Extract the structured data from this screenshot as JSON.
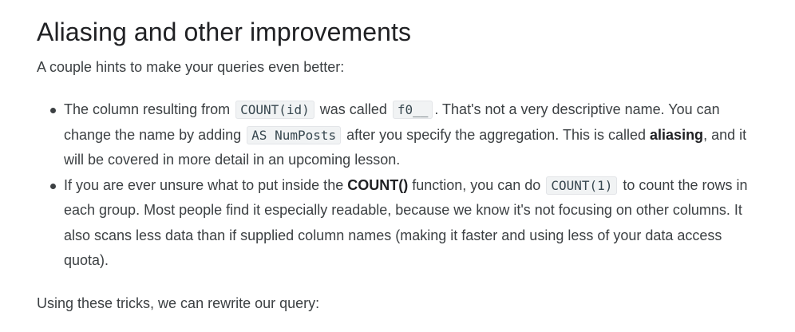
{
  "heading": "Aliasing and other improvements",
  "intro": "A couple hints to make your queries even better:",
  "bullets": [
    {
      "t1": "The column resulting from ",
      "c1": "COUNT(id)",
      "t2": " was called ",
      "c2": "f0__",
      "t3": ". That's not a very descriptive name. You can change the name by adding ",
      "c3": "AS NumPosts",
      "t4": " after you specify the aggregation. This is called ",
      "b1": "aliasing",
      "t5": ", and it will be covered in more detail in an upcoming lesson."
    },
    {
      "t1": "If you are ever unsure what to put inside the ",
      "b1": "COUNT()",
      "t2": " function, you can do ",
      "c1": "COUNT(1)",
      "t3": " to count the rows in each group. Most people find it especially readable, because we know it's not focusing on other columns. It also scans less data than if supplied column names (making it faster and using less of your data access quota)."
    }
  ],
  "outro": "Using these tricks, we can rewrite our query:"
}
